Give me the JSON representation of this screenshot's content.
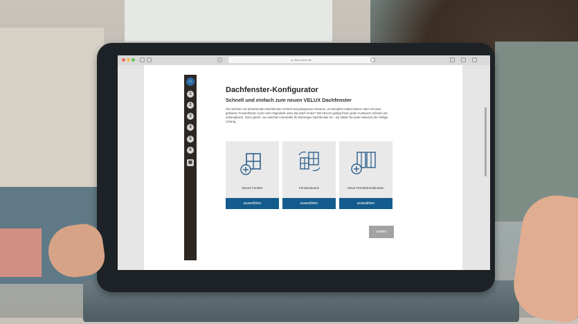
{
  "browser": {
    "url": "▲ dach-velux.de",
    "traffic_lights": [
      "#ee6b5f",
      "#f5bf4f",
      "#62c655"
    ]
  },
  "sidebar": {
    "steps": [
      {
        "label": "",
        "icon": "home-icon"
      },
      {
        "label": "1"
      },
      {
        "label": "2"
      },
      {
        "label": "3"
      },
      {
        "label": "4"
      },
      {
        "label": "5"
      },
      {
        "label": "6"
      },
      {
        "label": "",
        "icon": "grid-icon"
      }
    ]
  },
  "header": {
    "title": "Dachfenster-Konfigurator",
    "subtitle": "Schnell und einfach zum neuen VELUX Dachfenster",
    "intro": "Sie möchten ein bestehendes Dachfenster schnell und passgenau erneuern, es komplett modernisieren oder mit einer größeren Fensterfläche noch mehr Tageslicht unter das Dach holen? Mit VELUX gelingt Ihnen jeder Austausch schnell und unkompliziert. Ganz gleich, von welchem Hersteller Ihr bisheriges Dachfenster ist – wir haben für jeden Wunsch die richtige Lösung."
  },
  "options": [
    {
      "label": "Neues Fenster",
      "button": "auswählen",
      "icon": "add-window-icon"
    },
    {
      "label": "Fenstertausch",
      "button": "auswählen",
      "icon": "swap-window-icon"
    },
    {
      "label": "Neue Fensterkombination",
      "button": "auswählen",
      "icon": "window-combination-icon"
    }
  ],
  "footer": {
    "next_label": "weiter"
  },
  "colors": {
    "accent": "#135c8d",
    "nav": "#2c2723",
    "home": "#2d6aa3"
  }
}
